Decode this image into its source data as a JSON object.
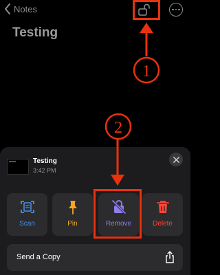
{
  "nav": {
    "back_label": "Notes"
  },
  "note": {
    "title": "Testing"
  },
  "sheet": {
    "file_name": "Testing",
    "file_time": "3:42 PM",
    "actions": [
      {
        "label": "Scan",
        "icon": "scan-icon",
        "color": "#4a8fe8"
      },
      {
        "label": "Pin",
        "icon": "pin-icon",
        "color": "#f5a623"
      },
      {
        "label": "Remove",
        "icon": "lock-slash-icon",
        "color": "#8f7ee8"
      },
      {
        "label": "Delete",
        "icon": "trash-icon",
        "color": "#ff453a"
      }
    ],
    "send_copy_label": "Send a Copy"
  },
  "annotations": {
    "step1": "1",
    "step2": "2",
    "color": "#e8320f"
  }
}
